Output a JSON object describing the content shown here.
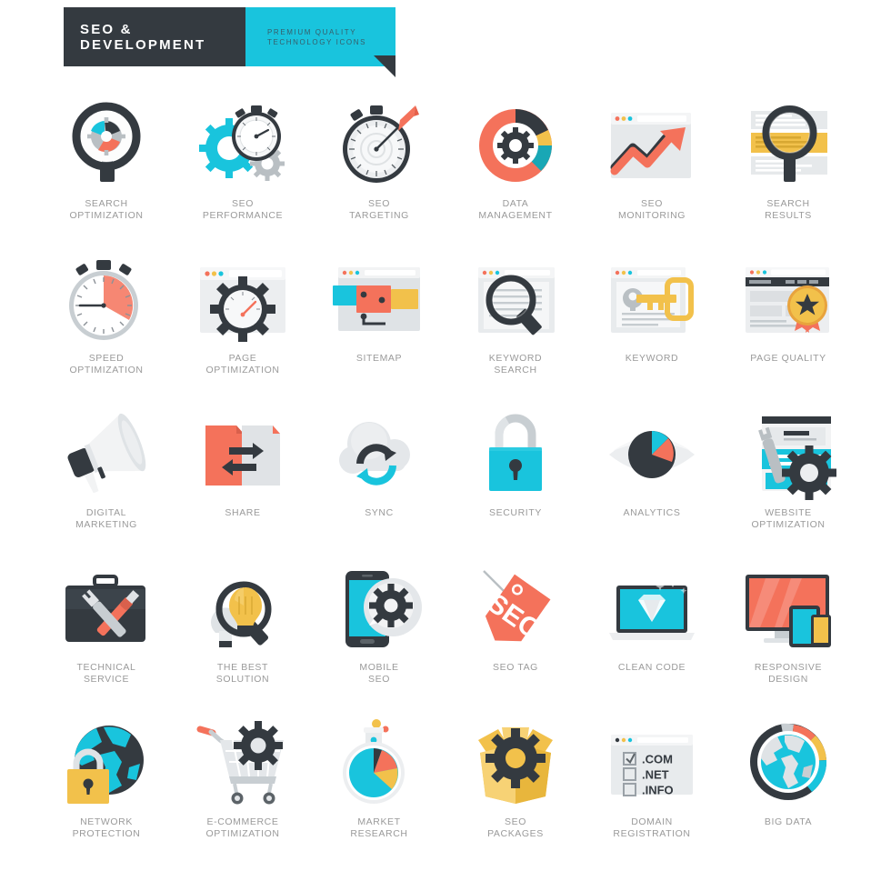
{
  "banner": {
    "title_line1": "SEO &",
    "title_line2": "DEVELOPMENT",
    "sub_line1": "PREMIUM QUALITY",
    "sub_line2": "TECHNOLOGY ICONS",
    "dark_color": "#343a40",
    "accent_color": "#19c4dd"
  },
  "palette": {
    "dark": "#343a40",
    "cyan": "#19c4dd",
    "coral": "#f4725b",
    "yellow": "#f2c14b",
    "grey_light": "#dfe2e4",
    "grey_mid": "#b9bfc3",
    "label": "#9a9a9a"
  },
  "domain_registration": {
    "options": [
      {
        "label": ".COM",
        "checked": true
      },
      {
        "label": ".NET",
        "checked": false
      },
      {
        "label": ".INFO",
        "checked": false
      }
    ]
  },
  "seo_tag": {
    "text": "SEO"
  },
  "icons": [
    {
      "id": "search-optimization",
      "label": "SEARCH\nOPTIMIZATION"
    },
    {
      "id": "seo-performance",
      "label": "SEO\nPERFORMANCE"
    },
    {
      "id": "seo-targeting",
      "label": "SEO\nTARGETING"
    },
    {
      "id": "data-management",
      "label": "DATA\nMANAGEMENT"
    },
    {
      "id": "seo-monitoring",
      "label": "SEO\nMONITORING"
    },
    {
      "id": "search-results",
      "label": "SEARCH\nRESULTS"
    },
    {
      "id": "speed-optimization",
      "label": "SPEED\nOPTIMIZATION"
    },
    {
      "id": "page-optimization",
      "label": "PAGE\nOPTIMIZATION"
    },
    {
      "id": "sitemap",
      "label": "SITEMAP"
    },
    {
      "id": "keyword-search",
      "label": "KEYWORD\nSEARCH"
    },
    {
      "id": "keyword",
      "label": "KEYWORD"
    },
    {
      "id": "page-quality",
      "label": "PAGE QUALITY"
    },
    {
      "id": "digital-marketing",
      "label": "DIGITAL\nMARKETING"
    },
    {
      "id": "share",
      "label": "SHARE"
    },
    {
      "id": "sync",
      "label": "SYNC"
    },
    {
      "id": "security",
      "label": "SECURITY"
    },
    {
      "id": "analytics",
      "label": "ANALYTICS"
    },
    {
      "id": "website-optimization",
      "label": "WEBSITE\nOPTIMIZATION"
    },
    {
      "id": "technical-service",
      "label": "TECHNICAL\nSERVICE"
    },
    {
      "id": "the-best-solution",
      "label": "THE BEST\nSOLUTION"
    },
    {
      "id": "mobile-seo",
      "label": "MOBILE\nSEO"
    },
    {
      "id": "seo-tag",
      "label": "SEO TAG"
    },
    {
      "id": "clean-code",
      "label": "CLEAN CODE"
    },
    {
      "id": "responsive-design",
      "label": "RESPONSIVE\nDESIGN"
    },
    {
      "id": "network-protection",
      "label": "NETWORK\nPROTECTION"
    },
    {
      "id": "e-commerce-optimization",
      "label": "E-COMMERCE\nOPTIMIZATION"
    },
    {
      "id": "market-research",
      "label": "MARKET\nRESEARCH"
    },
    {
      "id": "seo-packages",
      "label": "SEO\nPACKAGES"
    },
    {
      "id": "domain-registration",
      "label": "DOMAIN\nREGISTRATION"
    },
    {
      "id": "big-data",
      "label": "BIG DATA"
    }
  ]
}
